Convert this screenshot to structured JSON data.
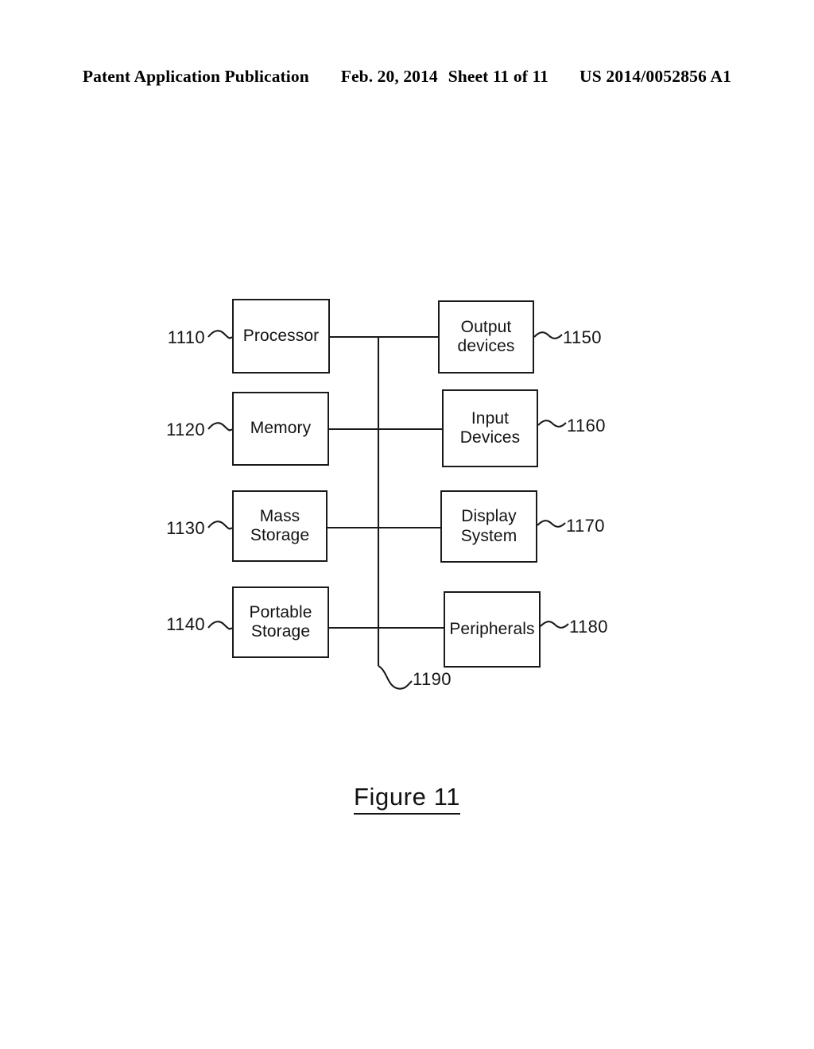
{
  "header": {
    "publication": "Patent Application Publication",
    "date": "Feb. 20, 2014",
    "sheet": "Sheet 11 of 11",
    "patent_number": "US 2014/0052856 A1"
  },
  "figure": {
    "caption": "Figure 11",
    "bus_label": "1190",
    "left_nodes": [
      {
        "ref": "1110",
        "lines": [
          "Processor"
        ]
      },
      {
        "ref": "1120",
        "lines": [
          "Memory"
        ]
      },
      {
        "ref": "1130",
        "lines": [
          "Mass",
          "Storage"
        ]
      },
      {
        "ref": "1140",
        "lines": [
          "Portable",
          "Storage"
        ]
      }
    ],
    "right_nodes": [
      {
        "ref": "1150",
        "lines": [
          "Output",
          "devices"
        ]
      },
      {
        "ref": "1160",
        "lines": [
          "Input",
          "Devices"
        ]
      },
      {
        "ref": "1170",
        "lines": [
          "Display",
          "System"
        ]
      },
      {
        "ref": "1180",
        "lines": [
          "Peripherals"
        ]
      }
    ]
  },
  "colors": {
    "ink": "#131313",
    "stroke": "#1a1a1a",
    "paper": "#ffffff"
  }
}
